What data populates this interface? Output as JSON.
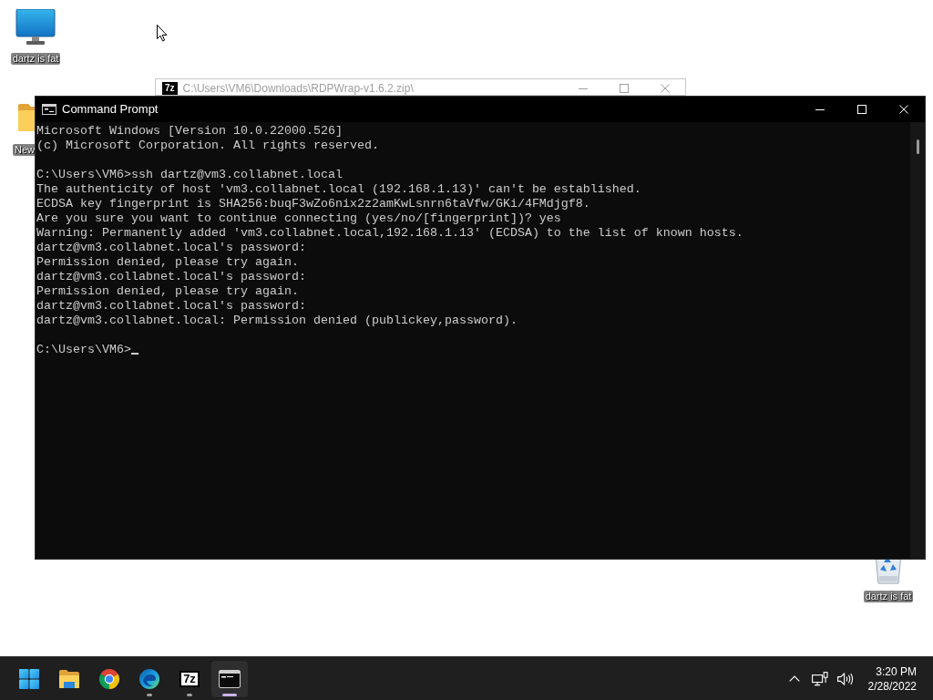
{
  "desktop": {
    "icons": [
      {
        "kind": "monitor",
        "label": "dartz is fat"
      },
      {
        "kind": "folder",
        "label": "New"
      },
      {
        "kind": "recycle_bin",
        "label": "dartz is fat"
      }
    ]
  },
  "windows": [
    {
      "kind": "archive",
      "icon_text": "7z",
      "title": "C:\\Users\\VM6\\Downloads\\RDPWrap-v1.6.2.zip\\",
      "active": false
    },
    {
      "kind": "console",
      "title": "Command Prompt",
      "active": true,
      "output_blocks": [
        [
          "Microsoft Windows [Version 10.0.22000.526]",
          "(c) Microsoft Corporation. All rights reserved."
        ],
        [
          "C:\\Users\\VM6>ssh dartz@vm3.collabnet.local",
          "The authenticity of host 'vm3.collabnet.local (192.168.1.13)' can't be established.",
          "ECDSA key fingerprint is SHA256:buqF3wZo6nix2z2amKwLsnrn6taVfw/GKi/4FMdjgf8.",
          "Are you sure you want to continue connecting (yes/no/[fingerprint])? yes",
          "Warning: Permanently added 'vm3.collabnet.local,192.168.1.13' (ECDSA) to the list of known hosts.",
          "dartz@vm3.collabnet.local's password:",
          "Permission denied, please try again.",
          "dartz@vm3.collabnet.local's password:",
          "Permission denied, please try again.",
          "dartz@vm3.collabnet.local's password:",
          "dartz@vm3.collabnet.local: Permission denied (publickey,password)."
        ]
      ],
      "prompt": "C:\\Users\\VM6>"
    }
  ],
  "taskbar": {
    "apps": [
      {
        "kind": "start",
        "running": false,
        "selected": false
      },
      {
        "kind": "file_explorer",
        "running": false,
        "selected": false
      },
      {
        "kind": "chrome",
        "running": false,
        "selected": false
      },
      {
        "kind": "edge",
        "running": true,
        "selected": false
      },
      {
        "kind": "archiver",
        "icon_text": "7z",
        "running": true,
        "selected": false
      },
      {
        "kind": "terminal",
        "running": true,
        "selected": true
      }
    ],
    "tray": {
      "time": "3:20 PM",
      "date": "2/28/2022"
    }
  }
}
